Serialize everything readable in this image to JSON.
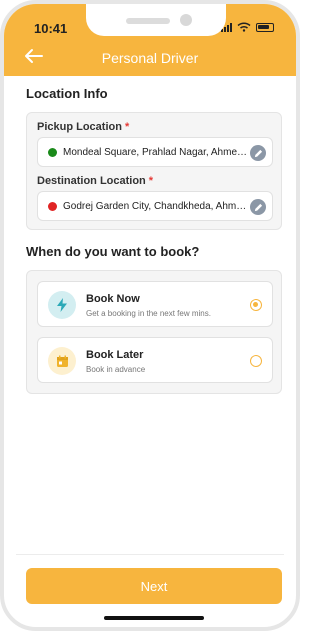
{
  "status_bar": {
    "time": "10:41"
  },
  "header": {
    "title": "Personal Driver"
  },
  "location": {
    "section_title": "Location Info",
    "pickup": {
      "label": "Pickup Location",
      "required_mark": "*",
      "value": "Mondeal Square, Prahlad Nagar, Ahmedabad"
    },
    "destination": {
      "label": "Destination Location",
      "required_mark": "*",
      "value": "Godrej Garden City, Chandkheda, Ahmedabad"
    }
  },
  "booking": {
    "section_title": "When do you want to book?",
    "options": [
      {
        "title": "Book Now",
        "subtitle": "Get a booking in the next few mins.",
        "icon": "lightning-icon",
        "selected": true
      },
      {
        "title": "Book Later",
        "subtitle": "Book in advance",
        "icon": "calendar-icon",
        "selected": false
      }
    ]
  },
  "footer": {
    "next_label": "Next"
  },
  "colors": {
    "accent": "#f7b53e",
    "pickup_dot": "#1a8a1a",
    "destination_dot": "#e02424"
  }
}
